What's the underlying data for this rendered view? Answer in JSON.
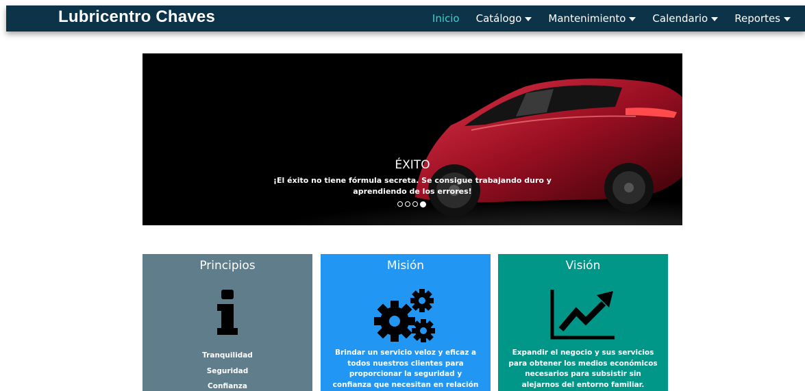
{
  "header": {
    "brand": "Lubricentro Chaves",
    "nav": [
      {
        "label": "Inicio",
        "active": true
      },
      {
        "label": "Catálogo",
        "dropdown": true
      },
      {
        "label": "Mantenimiento",
        "dropdown": true
      },
      {
        "label": "Calendario",
        "dropdown": true
      },
      {
        "label": "Reportes",
        "dropdown": true
      }
    ]
  },
  "carousel": {
    "title": "ÉXITO",
    "text": "¡El éxito no tiene fórmula secreta. Se consigue trabajando duro y aprendiendo de los errores!",
    "slides": 4,
    "active_slide": 4
  },
  "cards": {
    "principios": {
      "title": "Principios",
      "icon": "info-icon",
      "color": "#607d8b",
      "items": [
        "Tranquilidad",
        "Seguridad",
        "Confianza"
      ]
    },
    "mision": {
      "title": "Misión",
      "icon": "gears-icon",
      "color": "#2196f3",
      "text": "Brindar un servicio veloz y eficaz a todos nuestros clientes para proporcionar la seguridad y confianza que necesitan en relación a sus vehículos."
    },
    "vision": {
      "title": "Visión",
      "icon": "chart-growth-icon",
      "color": "#009688",
      "text": "Expandir el negocio y sus servicios para obtener los medios económicos necesarios para subsistir sin alejarnos del entorno familiar."
    }
  }
}
